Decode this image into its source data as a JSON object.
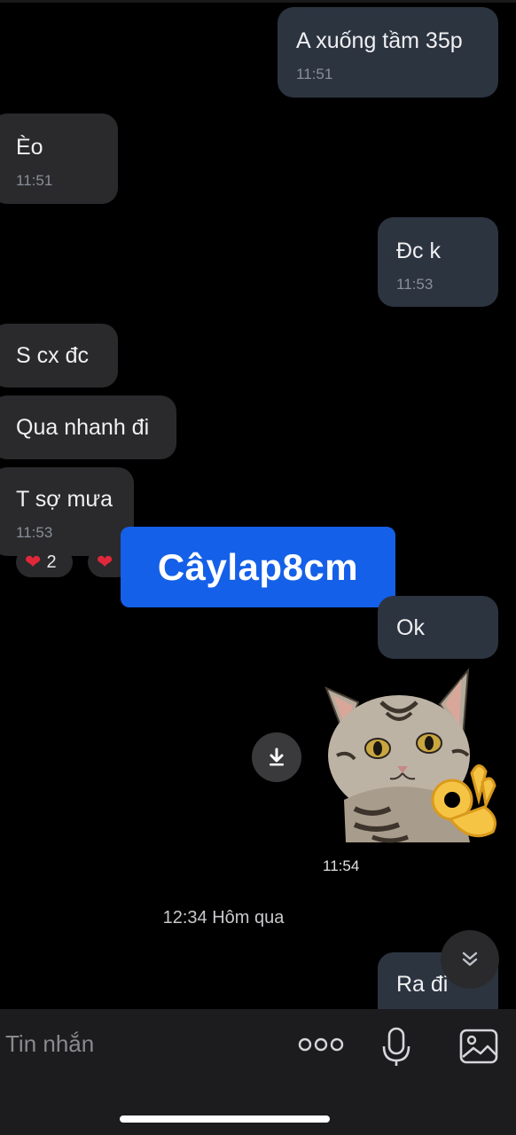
{
  "messages": [
    {
      "text": "A xuống tầm 35p",
      "time": "11:51",
      "direction": "out"
    },
    {
      "text": "Èo",
      "time": "11:51",
      "direction": "in"
    },
    {
      "text": "Đc k",
      "time": "11:53",
      "direction": "out"
    },
    {
      "text": "S cx đc",
      "direction": "in"
    },
    {
      "text": "Qua nhanh đi",
      "direction": "in"
    },
    {
      "text": "T sợ mưa",
      "time": "11:53",
      "direction": "in"
    },
    {
      "text": "Ok",
      "direction": "out"
    },
    {
      "text": "Ra đi",
      "direction": "out"
    }
  ],
  "reactions": [
    {
      "icon": "heart-icon",
      "count": "2"
    },
    {
      "icon": "heart-icon",
      "count": ""
    }
  ],
  "watermark": {
    "text": "Câylap8cm"
  },
  "sticker": {
    "time": "11:54",
    "icon": "cat-ok-sticker"
  },
  "date_separator": "12:34 Hôm qua",
  "composer": {
    "placeholder": "Tin nhắn"
  },
  "colors": {
    "outgoing_bubble": "#2c3440",
    "incoming_bubble": "#2a2a2c",
    "watermark_bg": "#1560e8",
    "heart": "#e0283a"
  }
}
